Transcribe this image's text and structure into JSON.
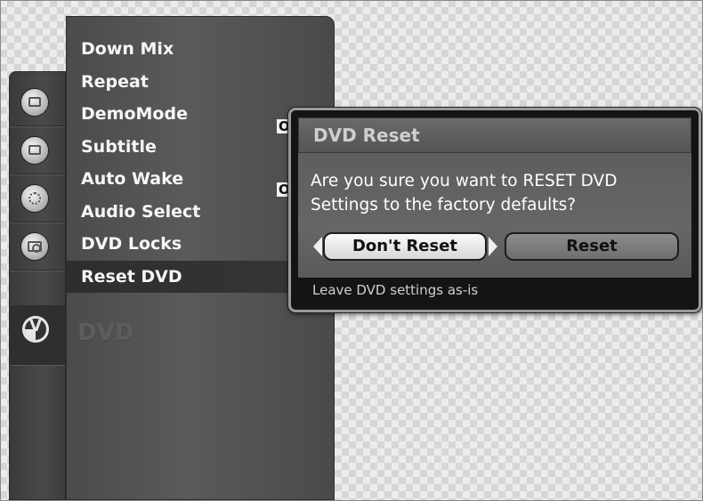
{
  "strip": {
    "items": [
      {
        "icon": "picture-icon"
      },
      {
        "icon": "tv-icon"
      },
      {
        "icon": "gear-icon"
      },
      {
        "icon": "camera-icon"
      },
      {
        "icon": "dvd-icon"
      }
    ]
  },
  "menu": {
    "items": [
      {
        "label": "Down Mix"
      },
      {
        "label": "Repeat"
      },
      {
        "label": "DemoMode"
      },
      {
        "label": "Subtitle"
      },
      {
        "label": "Auto Wake"
      },
      {
        "label": "Audio Select"
      },
      {
        "label": "DVD Locks"
      },
      {
        "label": "Reset DVD"
      }
    ],
    "selected_index": 7,
    "values": {
      "demo_mode": "OFF",
      "auto_wake": "O"
    },
    "category_label": "DVD"
  },
  "dialog": {
    "title": "DVD Reset",
    "message": "Are you sure you want to RESET DVD\nSettings to the factory defaults?",
    "buttons": {
      "dont_reset": "Don't Reset",
      "reset": "Reset"
    },
    "focused_button": "dont_reset",
    "status_text": "Leave DVD settings as-is"
  }
}
